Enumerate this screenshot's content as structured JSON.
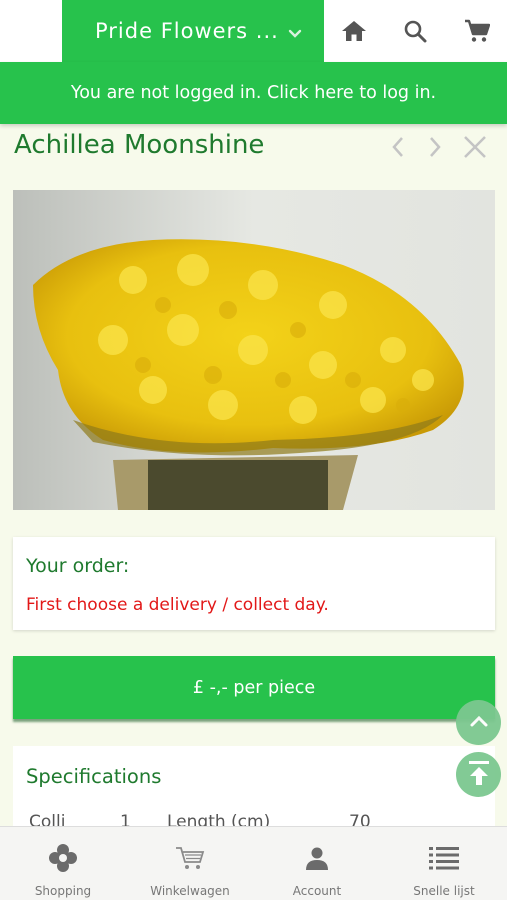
{
  "header": {
    "shop_name": "Pride Flowers ...",
    "icons": [
      "chevron-down-icon",
      "home-icon",
      "search-icon",
      "cart-icon"
    ]
  },
  "login_banner": "You are not logged in. Click here to log in.",
  "product": {
    "title": "Achillea Moonshine"
  },
  "order": {
    "heading": "Your order:",
    "message": "First choose a delivery / collect day."
  },
  "price_button": "£ -,- per piece",
  "specifications": {
    "heading": "Specifications",
    "colli_label": "Colli",
    "colli_value": "1",
    "length_label": "Length (cm)",
    "length_value": "70"
  },
  "tabs": [
    {
      "label": "Shopping",
      "icon": "flower-icon"
    },
    {
      "label": "Winkelwagen",
      "icon": "cart-icon"
    },
    {
      "label": "Account",
      "icon": "person-icon"
    },
    {
      "label": "Snelle lijst",
      "icon": "list-icon"
    }
  ],
  "colors": {
    "brand_green": "#27c24c",
    "title_green": "#1f7a2e",
    "error_red": "#e21818",
    "background": "#f7faeb"
  }
}
